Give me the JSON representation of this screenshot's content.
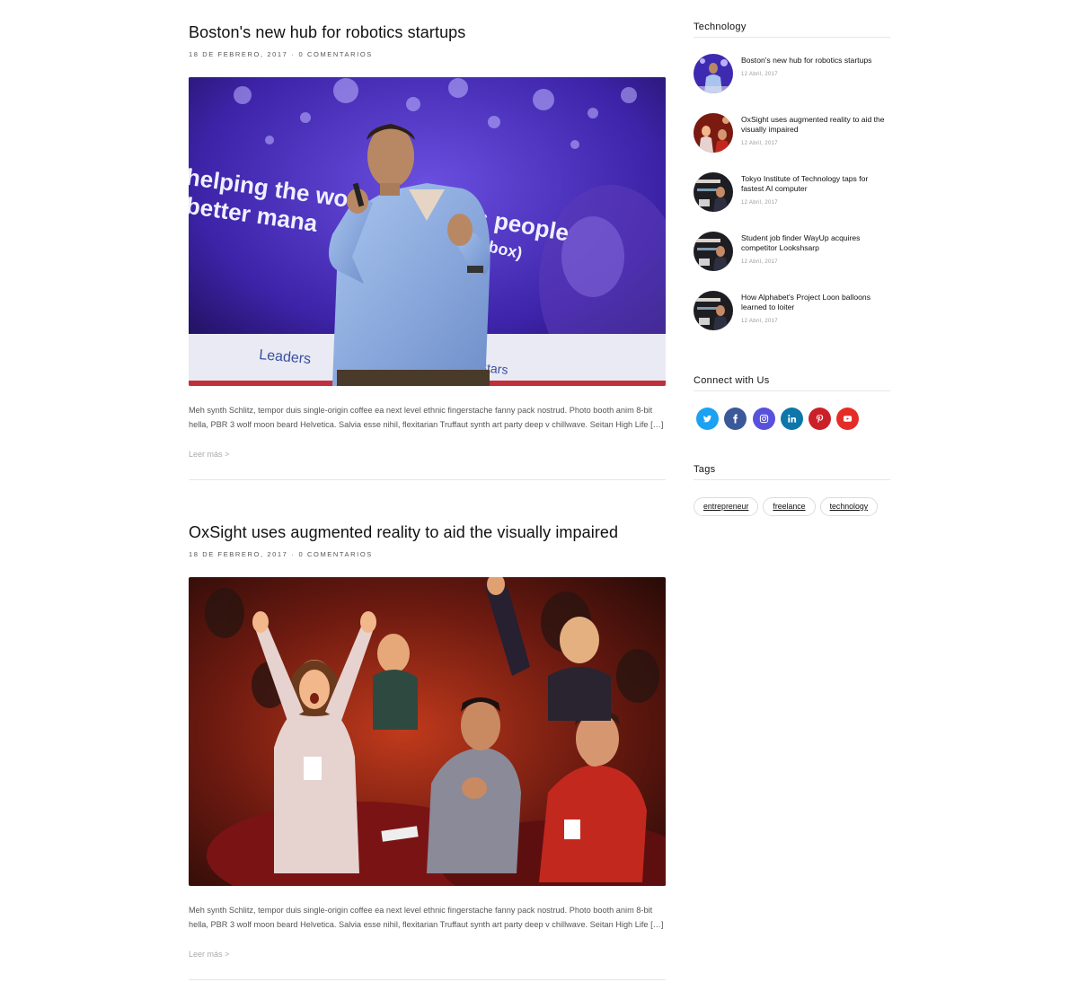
{
  "posts": [
    {
      "title": "Boston's new hub for robotics startups",
      "date": "18 DE FEBRERO, 2017",
      "comments": "0 COMENTARIOS",
      "image_description": "speaker",
      "excerpt": "Meh synth Schlitz, tempor duis single-origin coffee ea next level ethnic fingerstache fanny pack nostrud. Photo booth anim 8-bit hella, PBR 3 wolf moon beard Helvetica. Salvia esse nihil, flexitarian Truffaut synth art party deep v chillwave. Seitan High Life […]",
      "read_more": "Leer más >"
    },
    {
      "title": "OxSight uses augmented reality to aid the visually impaired",
      "date": "18 DE FEBRERO, 2017",
      "comments": "0 COMENTARIOS",
      "image_description": "audience",
      "excerpt": "Meh synth Schlitz, tempor duis single-origin coffee ea next level ethnic fingerstache fanny pack nostrud. Photo booth anim 8-bit hella, PBR 3 wolf moon beard Helvetica. Salvia esse nihil, flexitarian Truffaut synth art party deep v chillwave. Seitan High Life […]",
      "read_more": "Leer más >"
    }
  ],
  "slide_text": {
    "line1": "helping the wor",
    "line2": "better mana",
    "line3": "sies people",
    "line4": "nbox)",
    "footer_left": "Leaders",
    "footer_right": "ing Stars"
  },
  "sidebar": {
    "technology": {
      "title": "Technology",
      "items": [
        {
          "title": "Boston's new hub for robotics startups",
          "date": "12 Abril, 2017",
          "thumb": "blue"
        },
        {
          "title": "OxSight uses augmented reality to aid the visually impaired",
          "date": "12 Abril, 2017",
          "thumb": "red"
        },
        {
          "title": "Tokyo Institute of Technology taps for fastest AI computer",
          "date": "12 Abril, 2017",
          "thumb": "dark"
        },
        {
          "title": "Student job finder WayUp acquires competitor Lookshsarp",
          "date": "12 Abril, 2017",
          "thumb": "dark"
        },
        {
          "title": "How Alphabet's Project Loon balloons learned to loiter",
          "date": "12 Abril, 2017",
          "thumb": "dark"
        }
      ]
    },
    "connect": {
      "title": "Connect with Us",
      "icons": [
        {
          "name": "twitter-icon",
          "color": "#1da1f2"
        },
        {
          "name": "facebook-icon",
          "color": "#3b5998"
        },
        {
          "name": "instagram-icon",
          "color": "#5851db"
        },
        {
          "name": "linkedin-icon",
          "color": "#0e76a8"
        },
        {
          "name": "pinterest-icon",
          "color": "#cb2027"
        },
        {
          "name": "youtube-icon",
          "color": "#e52d27"
        }
      ]
    },
    "tags": {
      "title": "Tags",
      "items": [
        "entrepreneur",
        "freelance",
        "technology"
      ]
    }
  }
}
